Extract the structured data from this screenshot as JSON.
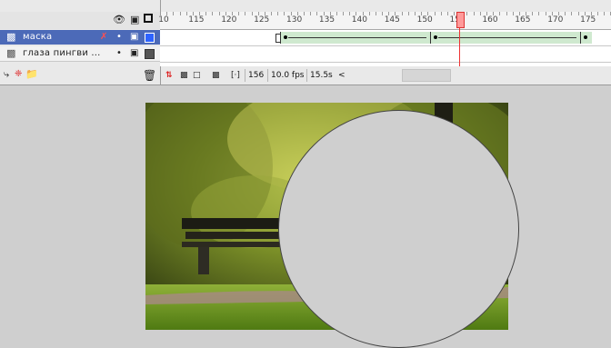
{
  "layers": [
    {
      "name": "маска",
      "selected": true
    },
    {
      "name": "глаза пингви ...",
      "selected": false
    }
  ],
  "ruler": {
    "labels": [
      "10",
      "115",
      "120",
      "125",
      "130",
      "135",
      "140",
      "145",
      "150",
      "155",
      "160",
      "165",
      "170",
      "175"
    ]
  },
  "status": {
    "frame": "156",
    "fps": "10.0 fps",
    "time": "15.5s",
    "scroll_left": "<"
  },
  "icons": {
    "eye": "eye-icon",
    "lock": "lock-icon",
    "outline": "outline-icon",
    "layer": "layer-icon",
    "pencil": "pencil-icon",
    "trash": "trash-icon",
    "new_layer": "new-layer-icon",
    "new_folder": "new-folder-icon"
  },
  "colors": {
    "selected_layer": "#4c6ab8",
    "tween": "#cfe9cf",
    "playhead": "#ff9a9a"
  }
}
